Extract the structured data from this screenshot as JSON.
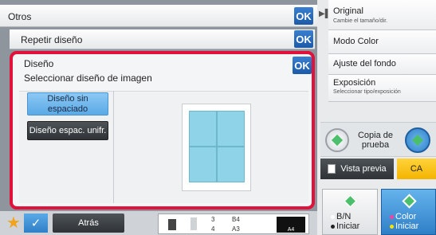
{
  "header": {
    "title": "Otros",
    "ok_label": "OK"
  },
  "repeat": {
    "label": "Repetir diseño",
    "ok_label": "OK"
  },
  "layout_panel": {
    "title": "Diseño",
    "subtitle": "Seleccionar diseño de imagen",
    "ok_label": "OK",
    "options": [
      {
        "label": "Diseño sin espaciado",
        "selected": true
      },
      {
        "label": "Diseño espac. unifr.",
        "selected": false
      }
    ]
  },
  "bottom": {
    "back_label": "Atrás",
    "tray": {
      "row1_num": "3",
      "row1_size": "B4",
      "row2_num": "4",
      "row2_size": "A3",
      "black_size": "A4"
    }
  },
  "right_menu": {
    "items": [
      {
        "label": "Original",
        "sub": "Cambie el tamaño/dir."
      },
      {
        "label": "Modo Color",
        "sub": ""
      },
      {
        "label": "Ajuste del fondo",
        "sub": ""
      },
      {
        "label": "Exposición",
        "sub": "Seleccionar tipo/exposición"
      }
    ]
  },
  "proof": {
    "label": "Copia de prueba"
  },
  "preview": {
    "label": "Vista previa"
  },
  "ca": {
    "label": "CA"
  },
  "start": {
    "bw_line1": "B/N",
    "bw_line2": "Iniciar",
    "color_line1": "Color",
    "color_line2": "Iniciar"
  },
  "colors": {
    "accent": "#e0113a",
    "ok_blue": "#1b5aa8",
    "selected_option": "#5aa9e6",
    "ca_yellow": "#f4b400",
    "green_icon": "#4bbf6b"
  }
}
